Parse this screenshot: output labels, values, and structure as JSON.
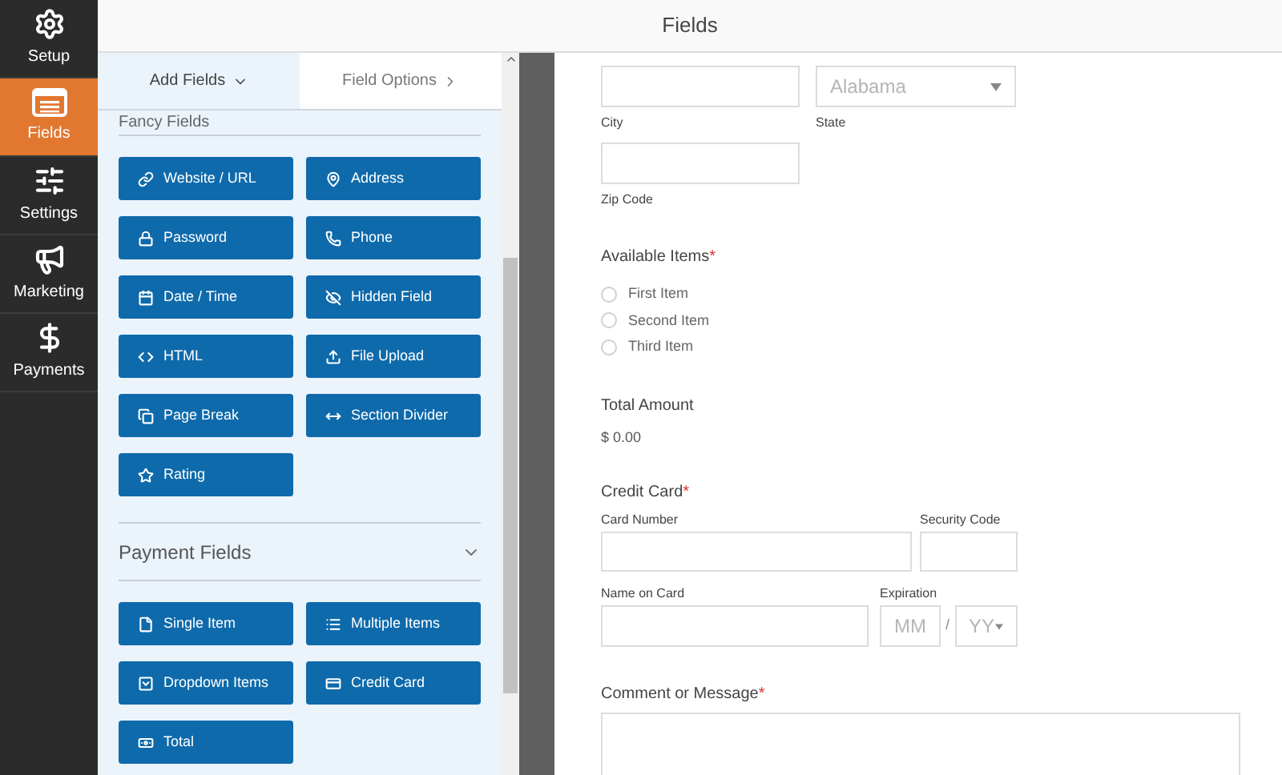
{
  "sidebar": {
    "items": [
      {
        "label": "Setup",
        "selected": false
      },
      {
        "label": "Fields",
        "selected": true
      },
      {
        "label": "Settings",
        "selected": false
      },
      {
        "label": "Marketing",
        "selected": false
      },
      {
        "label": "Payments",
        "selected": false
      }
    ]
  },
  "header": {
    "title": "Fields"
  },
  "panel": {
    "tabs": [
      {
        "label": "Add Fields",
        "selected": true
      },
      {
        "label": "Field Options",
        "selected": false
      }
    ],
    "sections": [
      {
        "title": "Fancy Fields",
        "fields": [
          "Website / URL",
          "Address",
          "Password",
          "Phone",
          "Date / Time",
          "Hidden Field",
          "HTML",
          "File Upload",
          "Page Break",
          "Section Divider",
          "Rating"
        ]
      },
      {
        "title": "Payment Fields",
        "fields": [
          "Single Item",
          "Multiple Items",
          "Dropdown Items",
          "Credit Card",
          "Total"
        ]
      }
    ]
  },
  "form": {
    "address": {
      "city_label": "City",
      "state_value": "Alabama",
      "state_label": "State",
      "zip_label": "Zip Code"
    },
    "available_items": {
      "label": "Available Items",
      "required": "*",
      "options": [
        {
          "label": "First Item",
          "selected": false
        },
        {
          "label": "Second Item",
          "selected": false
        },
        {
          "label": "Third Item",
          "selected": false
        }
      ]
    },
    "total": {
      "label": "Total Amount",
      "value": "$ 0.00"
    },
    "credit_card": {
      "label": "Credit Card",
      "required": "*",
      "card_number_label": "Card Number",
      "security_code_label": "Security Code",
      "name_label": "Name on Card",
      "expiration_label": "Expiration",
      "month_value": "MM",
      "separator": "/",
      "year_value": "YY"
    },
    "comment": {
      "label": "Comment or Message",
      "required": "*"
    }
  }
}
